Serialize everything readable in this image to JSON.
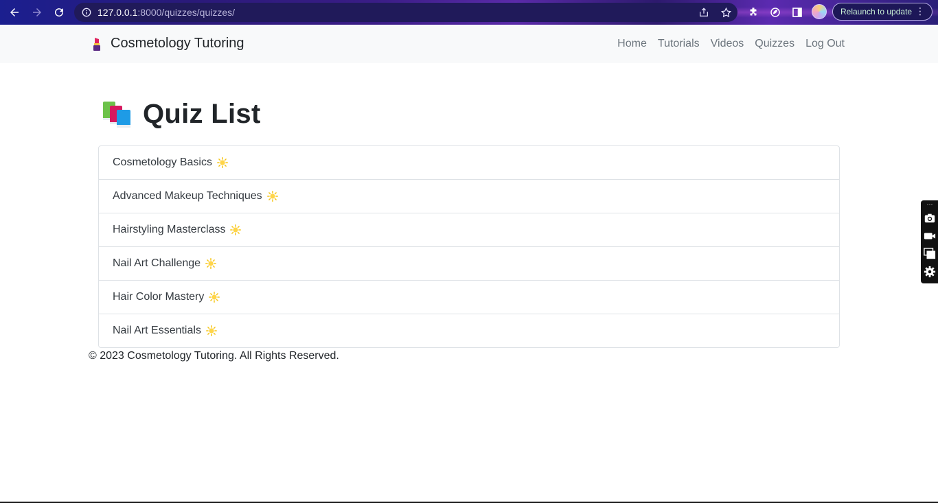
{
  "browser": {
    "url_host": "127.0.0.1",
    "url_path": ":8000/quizzes/quizzes/",
    "relaunch_label": "Relaunch to update",
    "icons": [
      "back-icon",
      "forward-icon",
      "reload-icon",
      "info-icon",
      "share-icon",
      "star-icon",
      "extensions-icon",
      "extension-leaf-icon",
      "sidepanel-icon",
      "avatar",
      "menu-icon"
    ]
  },
  "navbar": {
    "brand": "Cosmetology Tutoring",
    "brand_icon": "lipstick-icon",
    "links": [
      "Home",
      "Tutorials",
      "Videos",
      "Quizzes",
      "Log Out"
    ]
  },
  "main": {
    "title": "Quiz List",
    "title_icon": "books-icon",
    "quizzes": [
      "Cosmetology Basics",
      "Advanced Makeup Techniques",
      "Hairstyling Masterclass",
      "Nail Art Challenge",
      "Hair Color Mastery",
      "Nail Art Essentials"
    ],
    "quiz_icon": "sun-icon"
  },
  "footer": {
    "text": "© 2023 Cosmetology Tutoring. All Rights Reserved."
  },
  "side_toolbar": {
    "icons": [
      "camera-icon",
      "video-icon",
      "window-icon",
      "settings-icon"
    ]
  },
  "colors": {
    "navbar_bg": "#f8f9fa",
    "nav_link": "#6c757d",
    "border": "#dee2e6",
    "sun": "#f5c518"
  }
}
